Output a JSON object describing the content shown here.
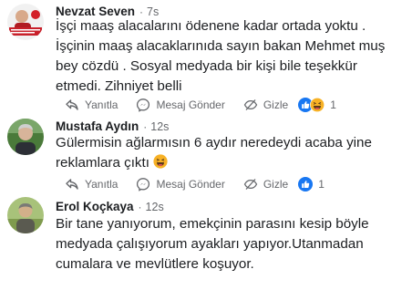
{
  "comments": [
    {
      "author": "Nevzat Seven",
      "separator": "·",
      "time": "7s",
      "text": "İşçi maaş alacalarını ödenene kadar ortada yoktu . İşçinin maaş alacaklarınıda sayın bakan Mehmet muş bey cözdü . Sosyal medyada bir kişi bile teşekkür etmedi. Zihniyet belli",
      "actions": {
        "reply": "Yanıtla",
        "message": "Mesaj Gönder",
        "hide": "Gizle"
      },
      "reaction_count": "1",
      "reaction_icons": [
        "like-icon",
        "haha-icon"
      ],
      "avatar_badge_text": "Nevzat Seven",
      "avatar_colors": {
        "bg": "#f1f1f1",
        "shirt": "#b01c22",
        "face": "#d8a98a"
      }
    },
    {
      "author": "Mustafa Aydın",
      "separator": "·",
      "time": "12s",
      "text": "Gülermisin ağlarmısın 6 aydır neredeydi acaba yine reklamlara çıktı",
      "emoji": "laughing-emoji",
      "actions": {
        "reply": "Yanıtla",
        "message": "Mesaj Gönder",
        "hide": "Gizle"
      },
      "reaction_count": "1",
      "reaction_icons": [
        "like-icon"
      ],
      "avatar_colors": {
        "bg": "#4a7a3a",
        "shirt": "#2c2f36",
        "face": "#d7b49a"
      }
    },
    {
      "author": "Erol Koçkaya",
      "separator": "·",
      "time": "12s",
      "text": "Bir tane yanıyorum, emekçinin parasını kesip böyle medyada çalışıyorum ayakları yapıyor.Utanmadan cumalara ve mevlütlere koşuyor.",
      "actions": {
        "reply": "Yanıtla",
        "message": "Mesaj Gönder",
        "hide": "Gizle"
      },
      "avatar_colors": {
        "bg": "#a8c27a",
        "shirt": "#5a5a50",
        "face": "#d2b08a"
      }
    }
  ],
  "colors": {
    "text": "#1c1e21",
    "secondary": "#65676b",
    "like_blue": "#1877f2",
    "haha_yellow": "#f7b125"
  }
}
